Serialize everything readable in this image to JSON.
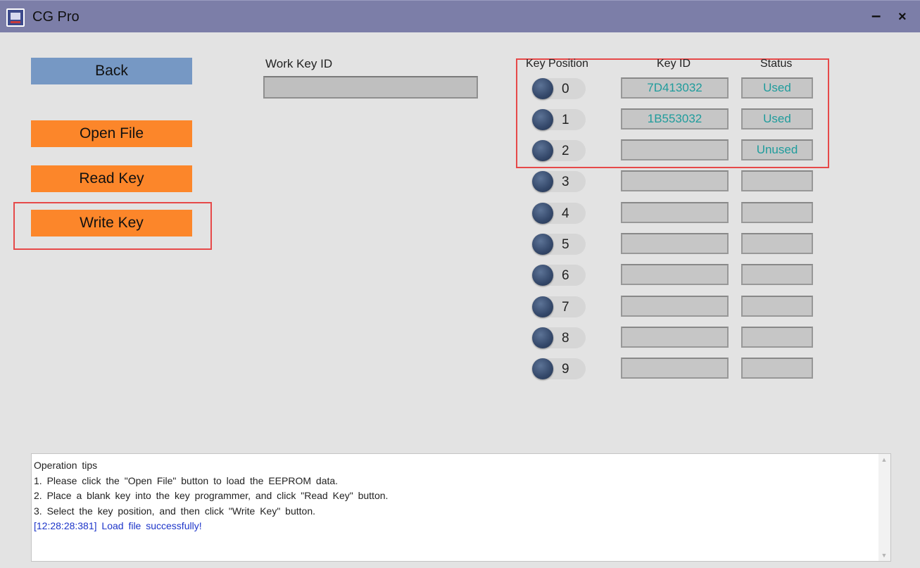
{
  "window": {
    "title": "CG Pro",
    "minimize_label": "–",
    "close_label": "×"
  },
  "left_panel": {
    "back_label": "Back",
    "open_file_label": "Open File",
    "read_key_label": "Read Key",
    "write_key_label": "Write Key"
  },
  "work_key": {
    "label": "Work Key ID",
    "value": ""
  },
  "key_table": {
    "headers": {
      "position": "Key Position",
      "key_id": "Key ID",
      "status": "Status"
    },
    "rows": [
      {
        "position": "0",
        "key_id": "7D413032",
        "status": "Used"
      },
      {
        "position": "1",
        "key_id": "1B553032",
        "status": "Used"
      },
      {
        "position": "2",
        "key_id": "",
        "status": "Unused"
      },
      {
        "position": "3",
        "key_id": "",
        "status": ""
      },
      {
        "position": "4",
        "key_id": "",
        "status": ""
      },
      {
        "position": "5",
        "key_id": "",
        "status": ""
      },
      {
        "position": "6",
        "key_id": "",
        "status": ""
      },
      {
        "position": "7",
        "key_id": "",
        "status": ""
      },
      {
        "position": "8",
        "key_id": "",
        "status": ""
      },
      {
        "position": "9",
        "key_id": "",
        "status": ""
      }
    ]
  },
  "log": {
    "lines": [
      "Operation tips",
      "1. Please click the \"Open File\" button to load the EEPROM data.",
      "2. Place a blank key into the key programmer, and click \"Read Key\" button.",
      "3. Select the key position, and then click \"Write Key\" button.",
      "[12:28:28:381] Load file successfully!"
    ]
  },
  "colors": {
    "titlebar": "#7c7ea8",
    "back_button": "#7698c4",
    "action_button": "#fc862a",
    "highlight_box": "#e64949",
    "value_text": "#1f9c9c",
    "log_success": "#1d35c9"
  },
  "icons": [
    "app-icon",
    "minimize-icon",
    "close-icon"
  ]
}
